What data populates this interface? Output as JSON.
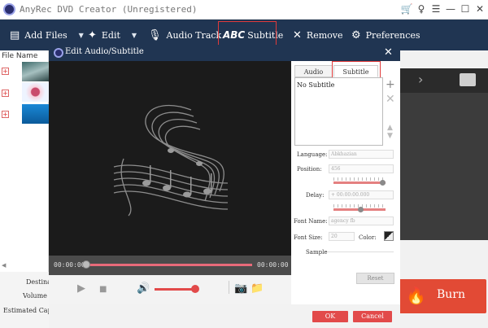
{
  "app": {
    "title": "AnyRec DVD Creator (Unregistered)"
  },
  "window_controls": [
    "🛒",
    "♀",
    "☰",
    "—",
    "☐",
    "✕"
  ],
  "toolbar": {
    "add_files": "Add Files",
    "edit": "Edit",
    "audio_track": "Audio Track",
    "subtitle_abc": "ABC",
    "subtitle": "Subtitle",
    "remove": "Remove",
    "preferences": "Preferences"
  },
  "filelist": {
    "header": "File Name"
  },
  "bottom": {
    "destination": "Destina",
    "volume": "Volume L",
    "estimated": "Estimated Capa"
  },
  "burn": {
    "label": "Burn"
  },
  "dialog": {
    "title": "Edit Audio/Subtitle",
    "close": "✕",
    "time_start": "00:00:00",
    "time_end": "00:00:00",
    "tabs": {
      "audio_track": "Audio Track",
      "subtitle": "Subtitle"
    },
    "subtitle_list": [
      "No Subtitle"
    ],
    "language_label": "Language:",
    "language_value": "Abkhazian",
    "position_label": "Position:",
    "position_value": "456",
    "delay_label": "Delay:",
    "delay_value": "+ 00:00:00.000",
    "font_name_label": "Font Name:",
    "font_name_value": "agency fb",
    "font_size_label": "Font Size:",
    "font_size_value": "20",
    "color_label": "Color:",
    "sample_label": "Sample",
    "reset": "Reset",
    "ok": "OK",
    "cancel": "Cancel"
  },
  "colors": {
    "toolbar": "#203552",
    "accent": "#e24a4a",
    "highlight": "#e03a3a"
  }
}
